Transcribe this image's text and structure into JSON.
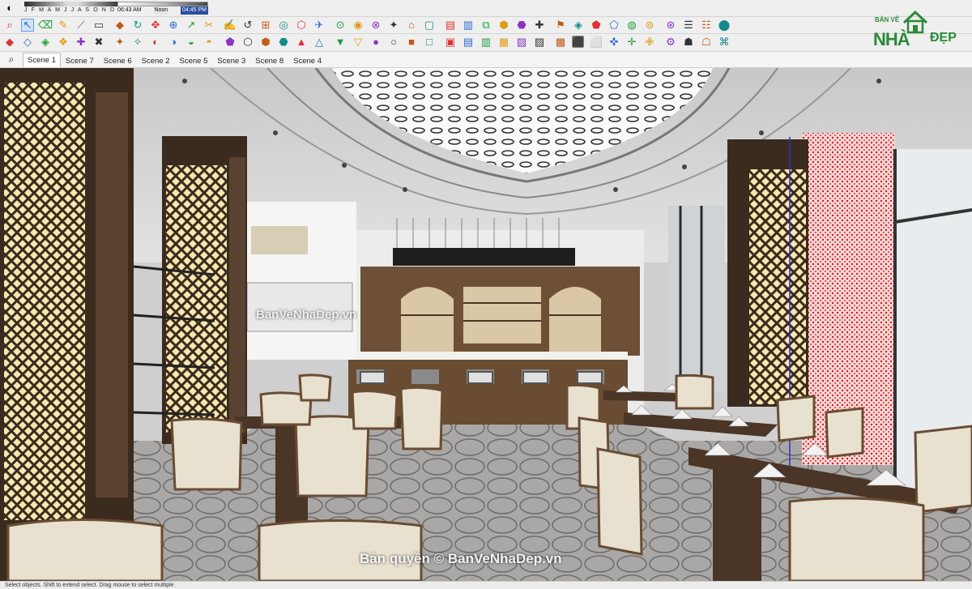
{
  "sun": {
    "months": "J F M A M J J A S O N D",
    "time_start": "06:43 AM",
    "time_mid": "Noon",
    "time_end": "04:45 PM"
  },
  "tabs": [
    "Scene 1",
    "Scene 7",
    "Scene 6",
    "Scene 2",
    "Scene 5",
    "Scene 3",
    "Scene 8",
    "Scene 4"
  ],
  "active_tab": "Scene 1",
  "viewport": {
    "watermark": "BanVeNhaDep.vn",
    "copyright": "Bản quyền © BanVeNhaDep.vn"
  },
  "logo": {
    "line1": "BẢN VẼ",
    "big": "NHÀ",
    "tail": "ĐẸP"
  },
  "status": "Select objects. Shift to extend select. Drag mouse to select multiple.",
  "colors": {
    "accent": "#2c8a3a",
    "selection": "#cfe3fb"
  }
}
